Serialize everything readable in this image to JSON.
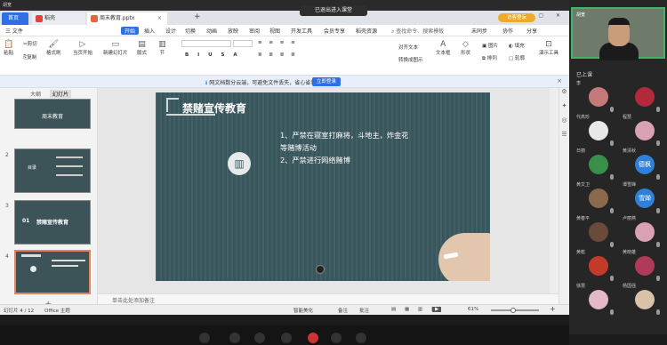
{
  "strip": {
    "title": "胡宽",
    "toast": "已退出进入课堂"
  },
  "tabs": [
    {
      "label": "首页"
    },
    {
      "label": "稻壳"
    },
    {
      "label": "周末教育.pptx"
    }
  ],
  "header": {
    "login_label": "访客登录"
  },
  "menu": [
    "三 文件",
    "开始",
    "插入",
    "设计",
    "切换",
    "动画",
    "放映",
    "审阅",
    "视图",
    "开发工具",
    "会员专享",
    "稻壳资源"
  ],
  "menu_right": {
    "search": "查找命令、搜索模板",
    "sync": "未同步",
    "collab": "协作",
    "share": "分享"
  },
  "ribbon": {
    "cut": "剪切",
    "paste": "粘贴",
    "copy": "复制",
    "format": "格式刷",
    "play": "当页开始",
    "new_slide": "新建幻灯片",
    "layout": "版式",
    "section": "节",
    "textbox": "文本框",
    "shape": "形状",
    "arrange": "排列",
    "image": "图片",
    "fill": "填充",
    "outline": "轮廓",
    "present": "演示工具",
    "align": "对齐文本",
    "text_direction": "转换成图示"
  },
  "notice": {
    "text": "网文档数分云端，可避免文件丢失，省心省事",
    "button": "立即登录"
  },
  "panel": {
    "tabs": [
      "大纲",
      "幻灯片"
    ]
  },
  "thumbs": [
    {
      "num": "",
      "title": "周末教育"
    },
    {
      "num": "2",
      "title": "目录"
    },
    {
      "num": "3",
      "title": "禁赌宣传教育"
    },
    {
      "num": "4",
      "title": ""
    }
  ],
  "slide": {
    "title": "禁赌宣传教育",
    "lines": [
      "1、严禁在寝室打麻将，斗地主，炸金花",
      "等赌博活动",
      "2、严禁进行网络赌博"
    ]
  },
  "notes": {
    "placeholder": "单击此处添加备注"
  },
  "status": {
    "slide_info": "幻灯片 4 / 12",
    "theme": "Office 主题",
    "beautify": "智能美化",
    "notes": "备注",
    "comment": "批注",
    "zoom": "61%"
  },
  "meeting": {
    "list_title": "已上课",
    "participants": [
      {
        "name": "李",
        "color": "#c47a7a",
        "initials": ""
      },
      {
        "name": "",
        "color": "#b02a3c",
        "initials": ""
      },
      {
        "name": "代高珍",
        "color": "#e8e8e8",
        "initials": ""
      },
      {
        "name": "程慧",
        "color": "#d9a1b4",
        "initials": ""
      },
      {
        "name": "日丽",
        "color": "#3a8f4a",
        "initials": ""
      },
      {
        "name": "黄清秋",
        "color": "#2f80d8",
        "initials": "德枫"
      },
      {
        "name": "黄文卫",
        "color": "#8a6a4a",
        "initials": ""
      },
      {
        "name": "谭雪婵",
        "color": "#2f80d8",
        "initials": "雪婵"
      },
      {
        "name": "黄春平",
        "color": "#6a4a3a",
        "initials": ""
      },
      {
        "name": "卢丽燕",
        "color": "#d9a1b4",
        "initials": ""
      },
      {
        "name": "黄乾",
        "color": "#c43a2a",
        "initials": ""
      },
      {
        "name": "黄晓雄",
        "color": "#b03a5a",
        "initials": ""
      },
      {
        "name": "徐慧",
        "color": "#e3b8c8",
        "initials": ""
      },
      {
        "name": "杨国强",
        "color": "#d8c2a8",
        "initials": ""
      }
    ]
  }
}
